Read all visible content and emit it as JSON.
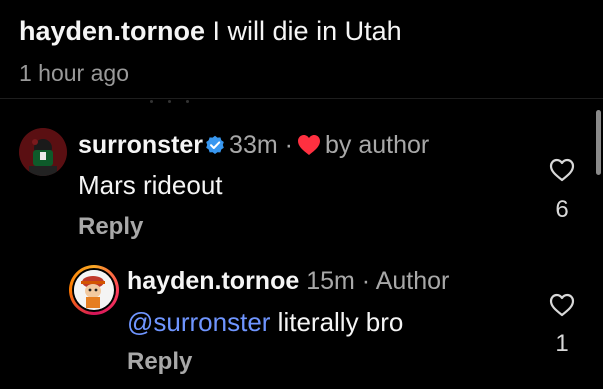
{
  "caption": {
    "username": "hayden.tornoe",
    "text": "I will die in Utah",
    "time": "1 hour ago"
  },
  "comments": [
    {
      "username": "surronster",
      "verified": true,
      "time": "33m",
      "separator": "·",
      "liked_by_author_label": "by author",
      "body": "Mars rideout",
      "reply_label": "Reply",
      "likes": "6"
    },
    {
      "username": "hayden.tornoe",
      "time": "15m",
      "separator": "·",
      "author_badge": "Author",
      "mention": "@surronster",
      "body": "literally bro",
      "reply_label": "Reply",
      "likes": "1"
    }
  ],
  "icons": {
    "verified": "verified-badge-icon",
    "author_like": "heart-filled-icon",
    "like": "heart-outline-icon"
  },
  "colors": {
    "background": "#000000",
    "mention": "#6f95ff",
    "verified": "#3897f0",
    "heart": "#ff3040"
  }
}
